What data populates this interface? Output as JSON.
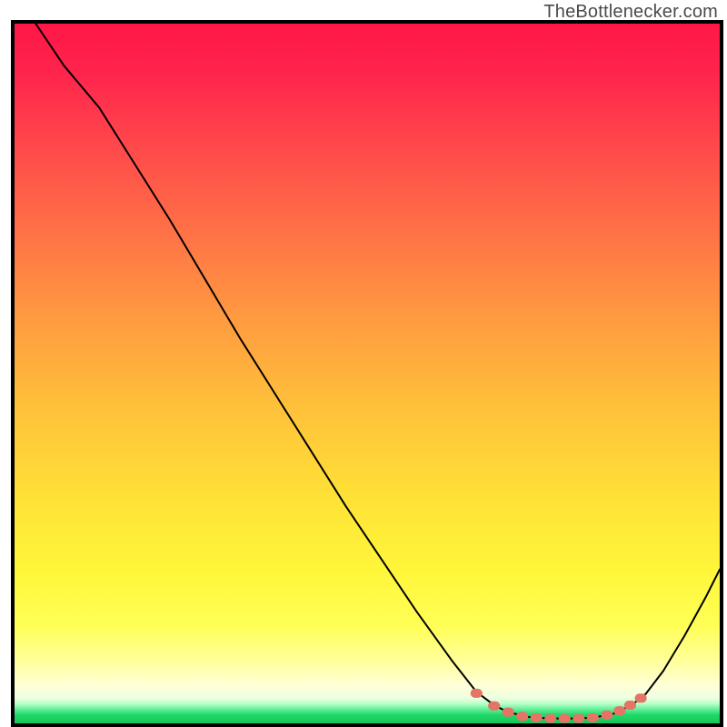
{
  "watermark": "TheBottlenecker.com",
  "colors": {
    "border": "#000000",
    "curve_stroke": "#000000",
    "marker_fill": "#e57366",
    "grad_top": "#ff1a49",
    "grad_mid_upper": "#ff8040",
    "grad_mid": "#ffd83a",
    "grad_mid_lower": "#ffff40",
    "grad_bottom_band": "#ffffb0",
    "grad_green": "#20e070"
  },
  "chart_data": {
    "type": "line",
    "title": "",
    "xlabel": "",
    "ylabel": "",
    "xlim": [
      0,
      100
    ],
    "ylim": [
      0,
      100
    ],
    "curve": [
      {
        "x": 3.0,
        "y": 100.0
      },
      {
        "x": 7.0,
        "y": 94.0
      },
      {
        "x": 12.0,
        "y": 88.0
      },
      {
        "x": 17.0,
        "y": 80.0
      },
      {
        "x": 22.0,
        "y": 72.0
      },
      {
        "x": 27.0,
        "y": 63.5
      },
      {
        "x": 32.0,
        "y": 55.0
      },
      {
        "x": 37.0,
        "y": 47.0
      },
      {
        "x": 42.0,
        "y": 39.0
      },
      {
        "x": 47.0,
        "y": 31.0
      },
      {
        "x": 52.0,
        "y": 23.5
      },
      {
        "x": 57.0,
        "y": 16.0
      },
      {
        "x": 62.0,
        "y": 9.0
      },
      {
        "x": 65.5,
        "y": 4.5
      },
      {
        "x": 68.0,
        "y": 2.6
      },
      {
        "x": 70.0,
        "y": 1.6
      },
      {
        "x": 73.0,
        "y": 0.9
      },
      {
        "x": 76.0,
        "y": 0.7
      },
      {
        "x": 79.0,
        "y": 0.7
      },
      {
        "x": 82.0,
        "y": 0.8
      },
      {
        "x": 85.0,
        "y": 1.4
      },
      {
        "x": 87.5,
        "y": 2.6
      },
      {
        "x": 89.5,
        "y": 4.2
      },
      {
        "x": 92.0,
        "y": 7.5
      },
      {
        "x": 95.0,
        "y": 12.5
      },
      {
        "x": 98.0,
        "y": 18.0
      },
      {
        "x": 100.0,
        "y": 22.0
      }
    ],
    "markers": [
      {
        "x": 65.5,
        "y": 4.3
      },
      {
        "x": 68.0,
        "y": 2.5
      },
      {
        "x": 70.0,
        "y": 1.6
      },
      {
        "x": 72.0,
        "y": 1.0
      },
      {
        "x": 74.0,
        "y": 0.8
      },
      {
        "x": 76.0,
        "y": 0.7
      },
      {
        "x": 78.0,
        "y": 0.7
      },
      {
        "x": 80.0,
        "y": 0.7
      },
      {
        "x": 82.0,
        "y": 0.8
      },
      {
        "x": 84.0,
        "y": 1.2
      },
      {
        "x": 85.8,
        "y": 1.8
      },
      {
        "x": 87.3,
        "y": 2.6
      },
      {
        "x": 88.8,
        "y": 3.6
      }
    ]
  }
}
